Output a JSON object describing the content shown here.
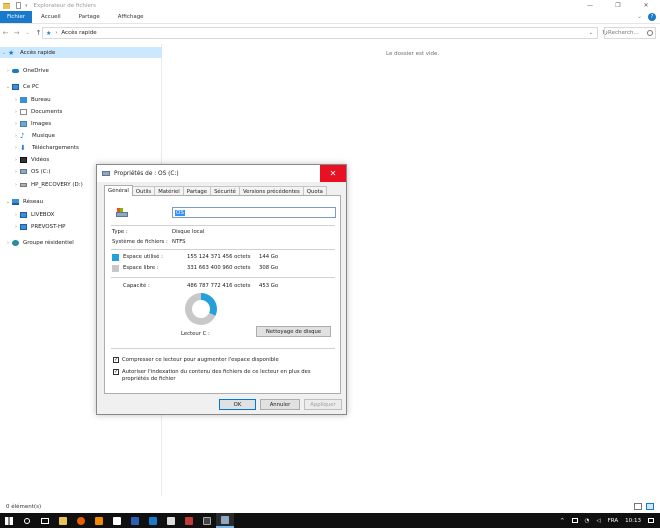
{
  "window": {
    "title": "Explorateur de fichiers",
    "controls": [
      "—",
      "❐",
      "✕"
    ]
  },
  "ribbon": {
    "tabs": [
      "Fichier",
      "Accueil",
      "Partage",
      "Affichage"
    ],
    "help": "?"
  },
  "address": {
    "path": "Accès rapide",
    "search_placeholder": "Recherch..."
  },
  "navpane": {
    "items": [
      {
        "label": "Accès rapide",
        "icon": "star-icon"
      },
      {
        "label": "OneDrive",
        "icon": "cloud-icon"
      },
      {
        "label": "Ce PC",
        "icon": "pc-icon"
      },
      {
        "label": "Bureau",
        "icon": "desktop-folder-icon"
      },
      {
        "label": "Documents",
        "icon": "documents-icon"
      },
      {
        "label": "Images",
        "icon": "images-icon"
      },
      {
        "label": "Musique",
        "icon": "music-icon"
      },
      {
        "label": "Téléchargements",
        "icon": "download-icon"
      },
      {
        "label": "Vidéos",
        "icon": "video-icon"
      },
      {
        "label": "OS (C:)",
        "icon": "drive-icon"
      },
      {
        "label": "HP_RECOVERY (D:)",
        "icon": "drive-icon"
      },
      {
        "label": "Réseau",
        "icon": "network-icon"
      },
      {
        "label": "LIVEBOX",
        "icon": "computer-icon"
      },
      {
        "label": "PREVOST-HP",
        "icon": "computer-icon"
      },
      {
        "label": "Groupe résidentiel",
        "icon": "homegroup-icon"
      }
    ]
  },
  "content": {
    "empty_message": "Le dossier est vide."
  },
  "statusbar": {
    "count": "0 élément(s)"
  },
  "taskbar": {
    "language": "FRA",
    "time": "10:13"
  },
  "dialog": {
    "title": "Propriétés de : OS (C:)",
    "tabs": [
      "Général",
      "Outils",
      "Matériel",
      "Partage",
      "Sécurité",
      "Versions précédentes",
      "Quota"
    ],
    "name_value": "OS",
    "type_label": "Type :",
    "type_value": "Disque local",
    "fs_label": "Système de fichiers :",
    "fs_value": "NTFS",
    "used_label": "Espace utilisé :",
    "used_bytes": "155 124 371 456 octets",
    "used_size": "144 Go",
    "free_label": "Espace libre :",
    "free_bytes": "331 663 400 960 octets",
    "free_size": "308 Go",
    "capacity_label": "Capacité :",
    "capacity_bytes": "486 787 772 416 octets",
    "capacity_size": "453 Go",
    "drive_label": "Lecteur C :",
    "cleanup_button": "Nettoyage de disque",
    "compress_label": "Compresser ce lecteur pour augmenter l'espace disponible",
    "index_label": "Autoriser l'indexation du contenu des fichiers de ce lecteur en plus des propriétés de fichier",
    "ok": "OK",
    "cancel": "Annuler",
    "apply": "Appliquer",
    "colors": {
      "used": "#26a0da",
      "free": "#c8c8c8"
    },
    "used_fraction": 0.319
  }
}
